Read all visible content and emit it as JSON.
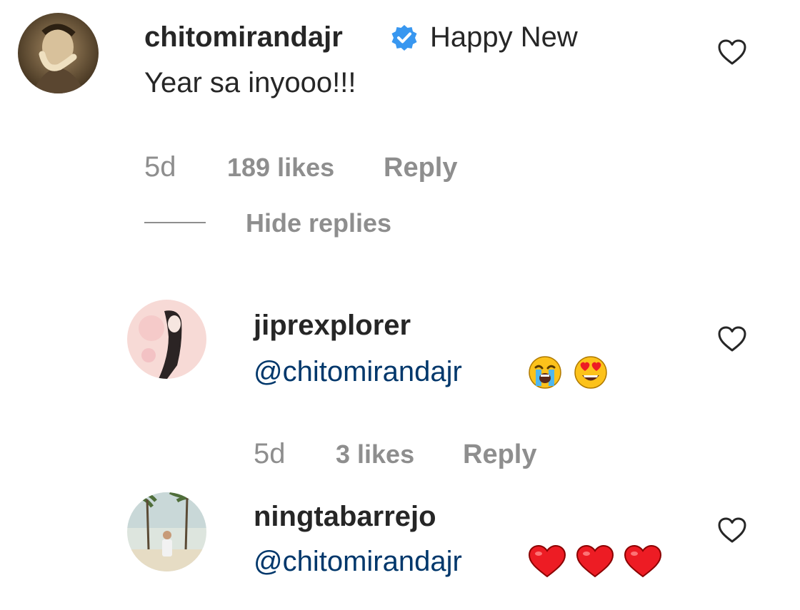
{
  "colors": {
    "text": "#262626",
    "muted": "#8e8e8e",
    "mention": "#00376b",
    "verified": "#3897f0",
    "emoji_heart": "#ed1c24"
  },
  "main_comment": {
    "username": "chitomirandajr",
    "verified_icon": "verified-badge-icon",
    "text_line1": "Happy New",
    "text_line2": "Year sa inyooo!!!",
    "time": "5d",
    "likes": "189 likes",
    "reply_label": "Reply",
    "like_icon": "heart-outline-icon"
  },
  "replies_toggle": {
    "label": "Hide replies"
  },
  "replies": [
    {
      "username": "jiprexplorer",
      "mention": "@chitomirandajr",
      "emojis": [
        "loudly-crying-face-emoji",
        "heart-eyes-emoji"
      ],
      "time": "5d",
      "likes": "3 likes",
      "reply_label": "Reply",
      "like_icon": "heart-outline-icon"
    },
    {
      "username": "ningtabarrejo",
      "mention": "@chitomirandajr",
      "emojis": [
        "red-heart-emoji",
        "red-heart-emoji",
        "red-heart-emoji"
      ],
      "like_icon": "heart-outline-icon"
    }
  ]
}
